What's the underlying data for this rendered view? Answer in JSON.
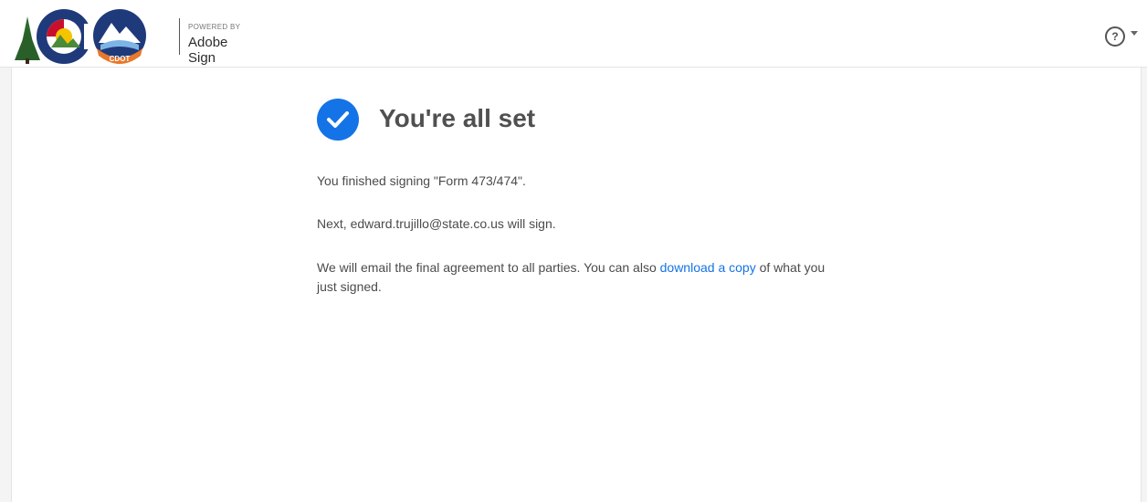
{
  "header": {
    "logo_badge_text": "CDOT",
    "powered_by": "POWERED BY",
    "brand": "Adobe Sign",
    "help_icon": "question-circle-icon",
    "help_glyph": "?"
  },
  "confirmation": {
    "icon": "checkmark-circle-icon",
    "accent_color": "#1473e6",
    "title": "You're all set",
    "finished_text": "You finished signing \"Form 473/474\".",
    "next_signer_text": "Next, edward.trujillo@state.co.us will sign.",
    "email_text_before": "We will email the final agreement to all parties. You can also ",
    "download_link": "download a copy",
    "email_text_after": " of what you just signed."
  }
}
